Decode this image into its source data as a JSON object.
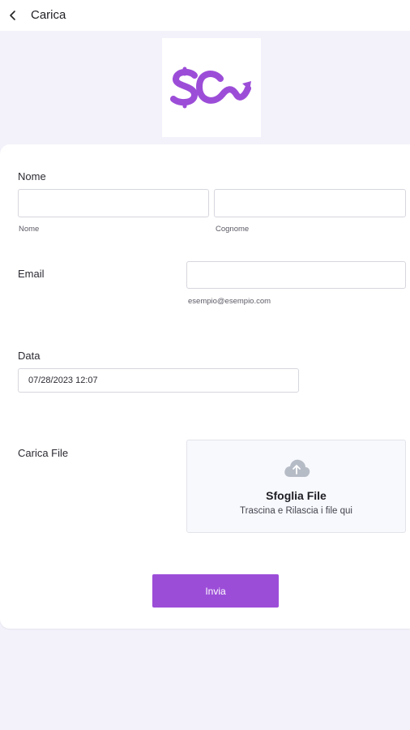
{
  "header": {
    "title": "Carica",
    "back_icon": "chevron-left-icon"
  },
  "logo": {
    "text": "SC",
    "color": "#9c4dd8"
  },
  "form": {
    "nome": {
      "label": "Nome",
      "first_value": "",
      "first_sublabel": "Nome",
      "last_value": "",
      "last_sublabel": "Cognome"
    },
    "email": {
      "label": "Email",
      "value": "",
      "sublabel": "esempio@esempio.com"
    },
    "data": {
      "label": "Data",
      "value": "07/28/2023 12:07"
    },
    "file": {
      "label": "Carica File",
      "icon": "cloud-upload-icon",
      "title": "Sfoglia File",
      "subtitle": "Trascina e Rilascia i file qui"
    },
    "submit_label": "Invia"
  },
  "colors": {
    "accent": "#9c4dd8",
    "background": "#f3f2fb"
  }
}
